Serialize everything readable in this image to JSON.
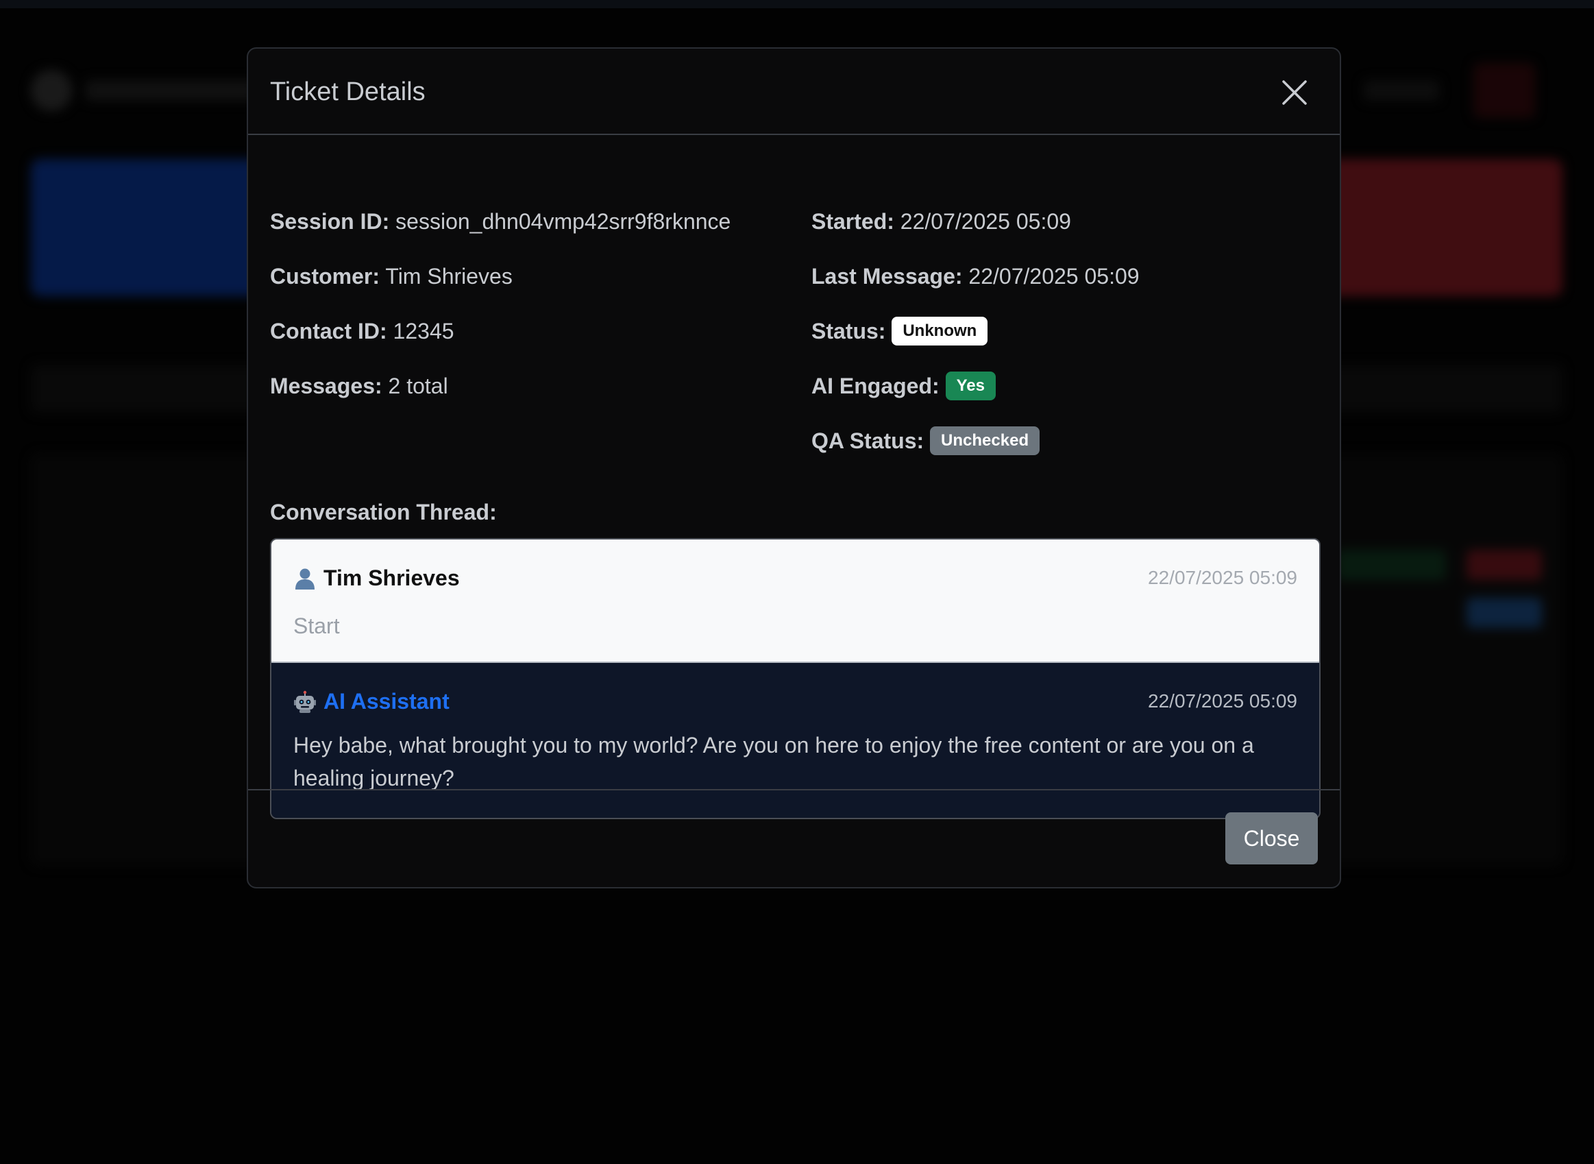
{
  "modal": {
    "title": "Ticket Details",
    "close_button_label": "Close"
  },
  "details_left": [
    {
      "label": "Session ID:",
      "value": "session_dhn04vmp42srr9f8rknnce"
    },
    {
      "label": "Customer:",
      "value": "Tim Shrieves"
    },
    {
      "label": "Contact ID:",
      "value": "12345"
    },
    {
      "label": "Messages:",
      "value": "2 total"
    }
  ],
  "details_right": {
    "started": {
      "label": "Started:",
      "value": "22/07/2025 05:09"
    },
    "last_message": {
      "label": "Last Message:",
      "value": "22/07/2025 05:09"
    },
    "status": {
      "label": "Status:",
      "badge": "Unknown"
    },
    "ai_engaged": {
      "label": "AI Engaged:",
      "badge": "Yes"
    },
    "qa_status": {
      "label": "QA Status:",
      "badge": "Unchecked"
    }
  },
  "thread": {
    "label": "Conversation Thread:",
    "messages": [
      {
        "sender": "Tim Shrieves",
        "icon": "user-icon",
        "time": "22/07/2025 05:09",
        "text": "Start"
      },
      {
        "sender": "AI Assistant",
        "icon": "robot-icon",
        "time": "22/07/2025 05:09",
        "text": "Hey babe, what brought you to my world? Are you on here to enjoy the free content or are you on a healing journey?"
      }
    ]
  },
  "colors": {
    "badge_success": "#198754",
    "badge_secondary": "#6c757d",
    "ai_sender": "#1e6ff2",
    "ai_message_bg": "#0e1628"
  }
}
